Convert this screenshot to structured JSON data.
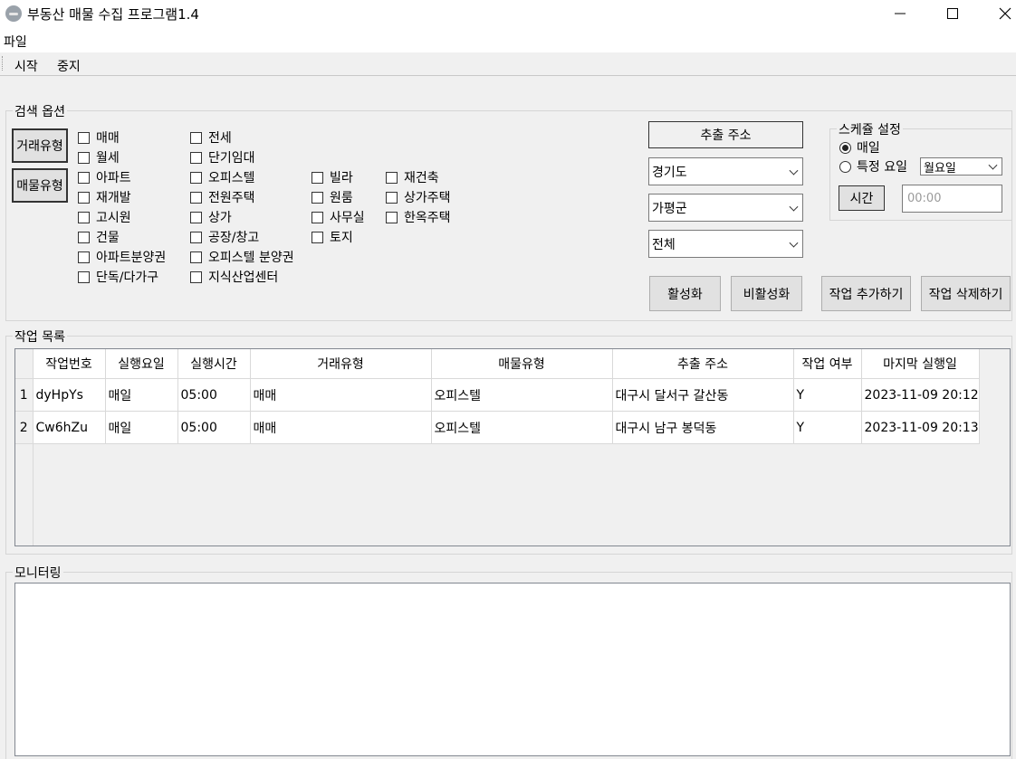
{
  "window": {
    "title": "부동산 매물 수집 프로그램1.4"
  },
  "menu": {
    "file": "파일"
  },
  "toolbar": {
    "start": "시작",
    "stop": "중지"
  },
  "search_options": {
    "group_label": "검색 옵션",
    "trade_type_button": "거래유형",
    "property_type_button": "매물유형",
    "trade_types": [
      "매매",
      "전세",
      "월세",
      "단기임대"
    ],
    "property_types": {
      "col1": [
        "아파트",
        "재개발",
        "고시원",
        "건물",
        "아파트분양권",
        "단독/다가구"
      ],
      "col2": [
        "오피스텔",
        "전원주택",
        "상가",
        "공장/창고",
        "오피스텔 분양권",
        "지식산업센터"
      ],
      "col3": [
        "빌라",
        "원룸",
        "사무실",
        "토지"
      ],
      "col4": [
        "재건축",
        "상가주택",
        "한옥주택"
      ]
    },
    "extract_address_button": "추출 주소",
    "province_select": "경기도",
    "city_select": "가평군",
    "district_select": "전체",
    "activate_button": "활성화",
    "deactivate_button": "비활성화",
    "add_job_button": "작업 추가하기",
    "delete_job_button": "작업 삭제하기"
  },
  "schedule": {
    "group_label": "스케쥴 설정",
    "daily": "매일",
    "specific_day": "특정 요일",
    "day_select": "월요일",
    "time_button": "시간",
    "time_placeholder": "00:00"
  },
  "job_list": {
    "group_label": "작업 목록",
    "columns": [
      "작업번호",
      "실행요일",
      "실행시간",
      "거래유형",
      "매물유형",
      "추출 주소",
      "작업 여부",
      "마지막 실행일"
    ],
    "rows": [
      {
        "index": "1",
        "cells": [
          "dyHpYs",
          "매일",
          "05:00",
          "매매",
          "오피스텔",
          "대구시 달서구 갈산동",
          "Y",
          "2023-11-09 20:12"
        ]
      },
      {
        "index": "2",
        "cells": [
          "Cw6hZu",
          "매일",
          "05:00",
          "매매",
          "오피스텔",
          "대구시 남구 봉덕동",
          "Y",
          "2023-11-09 20:13"
        ]
      }
    ]
  },
  "monitoring": {
    "group_label": "모니터링",
    "log": ""
  },
  "icons": {
    "minimize": "minimize-icon",
    "maximize": "maximize-icon",
    "close": "close-icon"
  }
}
